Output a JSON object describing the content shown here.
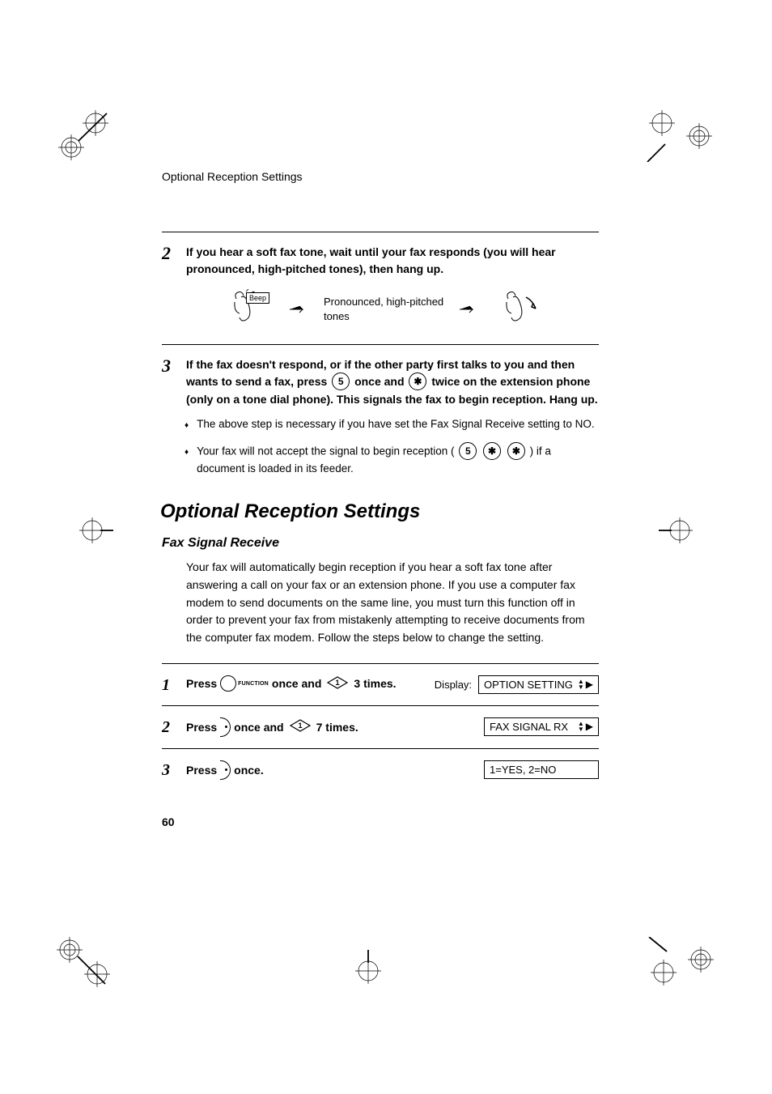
{
  "header": {
    "running_title": "Optional Reception Settings"
  },
  "step2": {
    "num": "2",
    "text": "If you hear a soft fax tone, wait until your fax responds (you will hear pronounced, high-pitched tones), then hang up.",
    "beep_label": "Beep",
    "illus_caption": "Pronounced, high-pitched tones"
  },
  "step3": {
    "num": "3",
    "text_a": "If the fax doesn't respond, or if the other party first talks to you and then wants to send a fax, press ",
    "key1": "5",
    "text_b": " once and ",
    "key2": "✱",
    "text_c": " twice on the extension phone (only on a tone dial phone). This signals the fax to begin reception. Hang up.",
    "bullet1": "The above step is necessary if you have set the Fax Signal Receive setting to NO.",
    "bullet2_a": "Your fax will not accept the signal to begin reception ( ",
    "bullet2_key1": "5",
    "bullet2_key2": "✱",
    "bullet2_key3": "✱",
    "bullet2_b": " ) if a document is loaded in its feeder."
  },
  "section": {
    "heading": "Optional Reception Settings",
    "sub_heading": "Fax Signal Receive",
    "paragraph": "Your fax will automatically begin reception if you hear a soft fax tone after answering a call on your fax or an extension phone. If you use a computer fax modem to send documents on the same line, you must turn this function off in order to prevent your fax from mistakenly attempting to receive documents from the computer fax modem. Follow the steps below to change the setting."
  },
  "settings": {
    "row1": {
      "num": "1",
      "press": "Press",
      "func_label": "FUNCTION",
      "mid": "once and",
      "diamond_num": "1",
      "tail": "3 times.",
      "display_label": "Display:",
      "display_value": "OPTION SETTING"
    },
    "row2": {
      "num": "2",
      "press": "Press",
      "mid": "once and",
      "diamond_num": "1",
      "tail": "7 times.",
      "display_value": "FAX SIGNAL RX"
    },
    "row3": {
      "num": "3",
      "press": "Press",
      "tail": "once.",
      "display_value": "1=YES, 2=NO"
    }
  },
  "footer": {
    "page_num": "60"
  }
}
